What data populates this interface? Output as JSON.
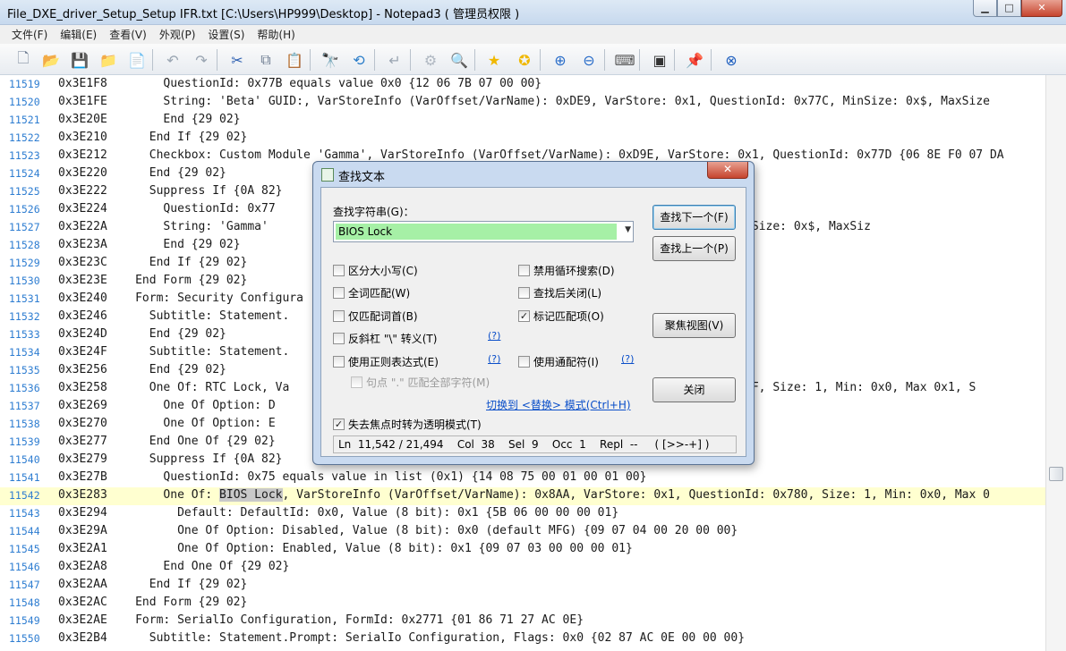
{
  "window": {
    "title": "File_DXE_driver_Setup_Setup IFR.txt [C:\\Users\\HP999\\Desktop] - Notepad3 ( 管理员权限 )",
    "min_label": "▁",
    "max_label": "□",
    "close_label": "✕"
  },
  "menu": [
    "文件(F)",
    "编辑(E)",
    "查看(V)",
    "外观(P)",
    "设置(S)",
    "帮助(H)"
  ],
  "toolbar_icons": [
    {
      "name": "new-file-icon",
      "glyph": "🗋",
      "color": "#6b7a8f"
    },
    {
      "name": "open-folder-icon",
      "glyph": "📂",
      "color": "#d9a21b"
    },
    {
      "name": "save-icon",
      "glyph": "💾",
      "color": "#8899aa"
    },
    {
      "name": "save-as-icon",
      "glyph": "📁",
      "color": "#d9a21b"
    },
    {
      "name": "save-copy-icon",
      "glyph": "📄",
      "color": "#2f9a3a"
    },
    {
      "name": "undo-icon",
      "glyph": "↶",
      "color": "#9aa5b2"
    },
    {
      "name": "redo-icon",
      "glyph": "↷",
      "color": "#9aa5b2"
    },
    {
      "name": "cut-icon",
      "glyph": "✂",
      "color": "#2a5db0"
    },
    {
      "name": "copy-icon",
      "glyph": "⧉",
      "color": "#6b7a8f"
    },
    {
      "name": "paste-icon",
      "glyph": "📋",
      "color": "#8a6a3a"
    },
    {
      "name": "find-icon",
      "glyph": "🔭",
      "color": "#333"
    },
    {
      "name": "replace-icon",
      "glyph": "⟲",
      "color": "#2a7dc9"
    },
    {
      "name": "goto-line-icon",
      "glyph": "↵",
      "color": "#9aa5b2"
    },
    {
      "name": "schemes-icon",
      "glyph": "⚙",
      "color": "#b0b8c2"
    },
    {
      "name": "zoom-search-icon",
      "glyph": "🔍",
      "color": "#b0b8c2"
    },
    {
      "name": "favorites-icon",
      "glyph": "★",
      "color": "#f0b800"
    },
    {
      "name": "add-favorite-icon",
      "glyph": "✪",
      "color": "#f0b800"
    },
    {
      "name": "zoom-in-icon",
      "glyph": "⊕",
      "color": "#2a6dc9"
    },
    {
      "name": "zoom-out-icon",
      "glyph": "⊖",
      "color": "#2a6dc9"
    },
    {
      "name": "keyboard-icon",
      "glyph": "⌨",
      "color": "#555"
    },
    {
      "name": "terminal-icon",
      "glyph": "▣",
      "color": "#333"
    },
    {
      "name": "pin-icon",
      "glyph": "📌",
      "color": "#2a6dc9"
    },
    {
      "name": "exit-icon",
      "glyph": "⊗",
      "color": "#1f5fbf"
    }
  ],
  "editor": {
    "lines": [
      {
        "num": "11519",
        "addr": "0x3E1F8",
        "indent": "        ",
        "text": "QuestionId: 0x77B equals value 0x0 {12 06 7B 07 00 00}"
      },
      {
        "num": "11520",
        "addr": "0x3E1FE",
        "indent": "        ",
        "text": "String: 'Beta' GUID:, VarStoreInfo (VarOffset/VarName): 0xDE9, VarStore: 0x1, QuestionId: 0x77C, MinSize: 0x$, MaxSize"
      },
      {
        "num": "11521",
        "addr": "0x3E20E",
        "indent": "        ",
        "text": "End {29 02}"
      },
      {
        "num": "11522",
        "addr": "0x3E210",
        "indent": "      ",
        "text": "End If {29 02}"
      },
      {
        "num": "11523",
        "addr": "0x3E212",
        "indent": "      ",
        "text": "Checkbox: Custom Module 'Gamma', VarStoreInfo (VarOffset/VarName): 0xD9E, VarStore: 0x1, QuestionId: 0x77D {06 8E F0 07 DA"
      },
      {
        "num": "11524",
        "addr": "0x3E220",
        "indent": "      ",
        "text": "End {29 02}"
      },
      {
        "num": "11525",
        "addr": "0x3E222",
        "indent": "      ",
        "text": "Suppress If {0A 82}"
      },
      {
        "num": "11526",
        "addr": "0x3E224",
        "indent": "        ",
        "text": "QuestionId: 0x77"
      },
      {
        "num": "11527",
        "addr": "0x3E22A",
        "indent": "        ",
        "text": "String: 'Gamma'                                             , QuestionId: 0x77E, MinSize: 0x$, MaxSiz"
      },
      {
        "num": "11528",
        "addr": "0x3E23A",
        "indent": "        ",
        "text": "End {29 02}"
      },
      {
        "num": "11529",
        "addr": "0x3E23C",
        "indent": "      ",
        "text": "End If {29 02}"
      },
      {
        "num": "11530",
        "addr": "0x3E23E",
        "indent": "    ",
        "text": "End Form {29 02}"
      },
      {
        "num": "11531",
        "addr": "0x3E240",
        "indent": "    ",
        "text": "Form: Security Configura"
      },
      {
        "num": "11532",
        "addr": "0x3E246",
        "indent": "      ",
        "text": "Subtitle: Statement.                                                          00}"
      },
      {
        "num": "11533",
        "addr": "0x3E24D",
        "indent": "      ",
        "text": "End {29 02}"
      },
      {
        "num": "11534",
        "addr": "0x3E24F",
        "indent": "      ",
        "text": "Subtitle: Statement."
      },
      {
        "num": "11535",
        "addr": "0x3E256",
        "indent": "      ",
        "text": "End {29 02}"
      },
      {
        "num": "11536",
        "addr": "0x3E258",
        "indent": "      ",
        "text": "One Of: RTC Lock, Va                                                         nId: 0x77F, Size: 1, Min: 0x0, Max 0x1, S"
      },
      {
        "num": "11537",
        "addr": "0x3E269",
        "indent": "        ",
        "text": "One Of Option: D"
      },
      {
        "num": "11538",
        "addr": "0x3E270",
        "indent": "        ",
        "text": "One Of Option: E"
      },
      {
        "num": "11539",
        "addr": "0x3E277",
        "indent": "      ",
        "text": "End One Of {29 02}"
      },
      {
        "num": "11540",
        "addr": "0x3E279",
        "indent": "      ",
        "text": "Suppress If {0A 82}"
      },
      {
        "num": "11541",
        "addr": "0x3E27B",
        "indent": "        ",
        "text": "QuestionId: 0x75 equals value in list (0x1) {14 08 75 00 01 00 01 00}"
      },
      {
        "num": "11542",
        "addr": "0x3E283",
        "indent": "        ",
        "text_pre": "One Of: ",
        "text_hl": "BIOS Lock",
        "text": ", VarStoreInfo (VarOffset/VarName): 0x8AA, VarStore: 0x1, QuestionId: 0x780, Size: 1, Min: 0x0, Max 0",
        "current": true
      },
      {
        "num": "11543",
        "addr": "0x3E294",
        "indent": "          ",
        "text": "Default: DefaultId: 0x0, Value (8 bit): 0x1 {5B 06 00 00 00 01}"
      },
      {
        "num": "11544",
        "addr": "0x3E29A",
        "indent": "          ",
        "text": "One Of Option: Disabled, Value (8 bit): 0x0 (default MFG) {09 07 04 00 20 00 00}"
      },
      {
        "num": "11545",
        "addr": "0x3E2A1",
        "indent": "          ",
        "text": "One Of Option: Enabled, Value (8 bit): 0x1 {09 07 03 00 00 00 01}"
      },
      {
        "num": "11546",
        "addr": "0x3E2A8",
        "indent": "        ",
        "text": "End One Of {29 02}"
      },
      {
        "num": "11547",
        "addr": "0x3E2AA",
        "indent": "      ",
        "text": "End If {29 02}"
      },
      {
        "num": "11548",
        "addr": "0x3E2AC",
        "indent": "    ",
        "text": "End Form {29 02}"
      },
      {
        "num": "11549",
        "addr": "0x3E2AE",
        "indent": "    ",
        "text": "Form: SerialIo Configuration, FormId: 0x2771 {01 86 71 27 AC 0E}"
      },
      {
        "num": "11550",
        "addr": "0x3E2B4",
        "indent": "      ",
        "text": "Subtitle: Statement.Prompt: SerialIo Configuration, Flags: 0x0 {02 87 AC 0E 00 00 00}"
      }
    ]
  },
  "find_dialog": {
    "title": "查找文本",
    "close_label": "✕",
    "search_label": "查找字符串(G)：",
    "search_value": "BIOS Lock",
    "find_next": "查找下一个(F)",
    "find_prev": "查找上一个(P)",
    "focus_view": "聚焦视图(V)",
    "close_btn": "关闭",
    "options_left": [
      {
        "label": "区分大小写(C)",
        "checked": false
      },
      {
        "label": "全词匹配(W)",
        "checked": false
      },
      {
        "label": "仅匹配词首(B)",
        "checked": false
      },
      {
        "label": "反斜杠 \"\\\" 转义(T)",
        "checked": false
      },
      {
        "label": "使用正则表达式(E)",
        "checked": false
      }
    ],
    "options_right": [
      {
        "label": "禁用循环搜索(D)",
        "checked": false
      },
      {
        "label": "查找后关闭(L)",
        "checked": false
      },
      {
        "label": "标记匹配项(O)",
        "checked": true
      }
    ],
    "wildcard": {
      "label": "使用通配符(I)",
      "checked": false
    },
    "dot_all": {
      "label": "句点 \".\" 匹配全部字符(M)",
      "checked": false
    },
    "help_mark": "(?)",
    "switch_link": "切换到 <替换> 模式(Ctrl+H)",
    "transparent": {
      "label": "失去焦点时转为透明模式(T)",
      "checked": true
    },
    "status": "Ln  11,542 / 21,494    Col  38    Sel  9    Occ  1    Repl  --     ( [>>-+] )"
  }
}
